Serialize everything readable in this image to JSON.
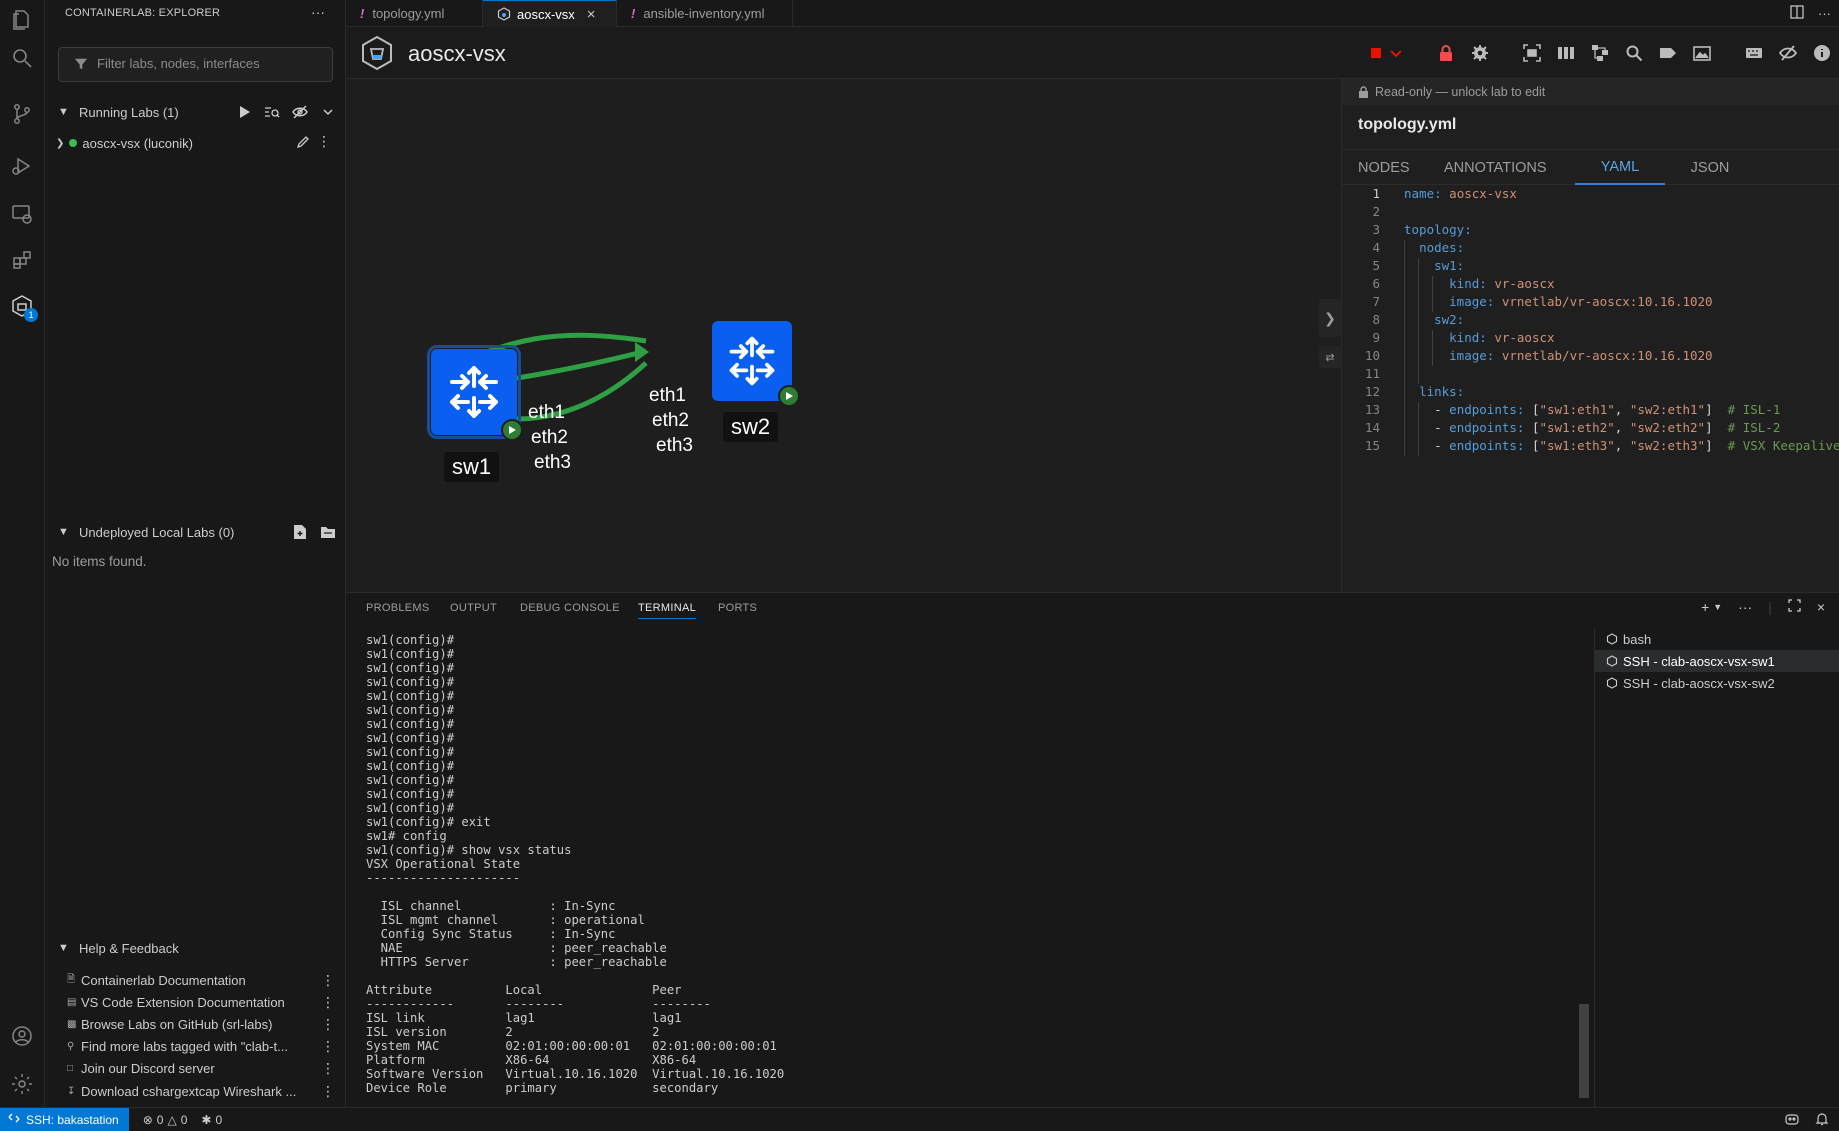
{
  "sidebar": {
    "title": "CONTAINERLAB: EXPLORER",
    "filter_placeholder": "Filter labs, nodes, interfaces",
    "running_labs": {
      "label": "Running Labs (1)",
      "items": [
        {
          "label": "aoscx-vsx (luconik)",
          "status": "running"
        }
      ]
    },
    "undeployed": {
      "label": "Undeployed Local Labs (0)",
      "empty_text": "No items found."
    },
    "help": {
      "label": "Help & Feedback",
      "items": [
        {
          "label": "Containerlab Documentation",
          "icon": "doc-icon"
        },
        {
          "label": "VS Code Extension Documentation",
          "icon": "doc-icon"
        },
        {
          "label": "Browse Labs on GitHub (srl-labs)",
          "icon": "folder-icon"
        },
        {
          "label": "Find more labs tagged with \"clab-t...",
          "icon": "search-icon"
        },
        {
          "label": "Join our Discord server",
          "icon": "chat-icon"
        },
        {
          "label": "Download cshargextcap Wireshark ...",
          "icon": "download-icon"
        }
      ]
    },
    "activity_badge": "1"
  },
  "tabs": [
    {
      "label": "topology.yml",
      "active": false
    },
    {
      "label": "aoscx-vsx",
      "active": true
    },
    {
      "label": "ansible-inventory.yml",
      "active": false
    }
  ],
  "graph": {
    "title": "aoscx-vsx",
    "nodes": [
      {
        "label": "sw1"
      },
      {
        "label": "sw2"
      }
    ],
    "sw1_ifaces": [
      "eth1",
      "eth2",
      "eth3"
    ],
    "sw2_ifaces": [
      "eth1",
      "eth2",
      "eth3"
    ]
  },
  "props": {
    "readonly_text": "Read-only — unlock lab to edit",
    "file_title": "topology.yml",
    "tabs": [
      "NODES",
      "ANNOTATIONS",
      "YAML",
      "JSON"
    ],
    "active_tab": "YAML",
    "yaml_lines": [
      "1",
      "2",
      "3",
      "4",
      "5",
      "6",
      "7",
      "8",
      "9",
      "10",
      "11",
      "12",
      "13",
      "14",
      "15"
    ],
    "yaml": {
      "name_key": "name:",
      "name_val": "aoscx-vsx",
      "topology_key": "topology:",
      "nodes_key": "nodes:",
      "sw1_key": "sw1:",
      "sw2_key": "sw2:",
      "kind_key": "kind:",
      "kind_val": "vr-aoscx",
      "image_key": "image:",
      "image_val": "vrnetlab/vr-aoscx:10.16.1020",
      "links_key": "links:",
      "endpoints_key": "endpoints:",
      "link1_a": "\"sw1:eth1\"",
      "link1_b": "\"sw2:eth1\"",
      "link1_c": "# ISL-1",
      "link2_a": "\"sw1:eth2\"",
      "link2_b": "\"sw2:eth2\"",
      "link2_c": "# ISL-2",
      "link3_a": "\"sw1:eth3\"",
      "link3_b": "\"sw2:eth3\"",
      "link3_c": "# VSX Keepalive"
    }
  },
  "panel": {
    "tabs": [
      "PROBLEMS",
      "OUTPUT",
      "DEBUG CONSOLE",
      "TERMINAL",
      "PORTS"
    ],
    "active_tab": "TERMINAL",
    "terminal_lines": [
      "sw1(config)#",
      "sw1(config)#",
      "sw1(config)#",
      "sw1(config)#",
      "sw1(config)#",
      "sw1(config)#",
      "sw1(config)#",
      "sw1(config)#",
      "sw1(config)#",
      "sw1(config)#",
      "sw1(config)#",
      "sw1(config)#",
      "sw1(config)#",
      "sw1(config)# exit",
      "sw1# config",
      "sw1(config)# show vsx status",
      "VSX Operational State",
      "---------------------",
      "",
      "  ISL channel            : In-Sync",
      "  ISL mgmt channel       : operational",
      "  Config Sync Status     : In-Sync",
      "  NAE                    : peer_reachable",
      "  HTTPS Server           : peer_reachable",
      "",
      "Attribute          Local               Peer",
      "------------       --------            --------",
      "ISL link           lag1                lag1",
      "ISL version        2                   2",
      "System MAC         02:01:00:00:00:01   02:01:00:00:00:01",
      "Platform           X86-64              X86-64",
      "Software Version   Virtual.10.16.1020  Virtual.10.16.1020",
      "Device Role        primary             secondary",
      ""
    ],
    "prompt": "sw1(config)# ",
    "terminals": [
      {
        "label": "bash"
      },
      {
        "label": "SSH - clab-aoscx-vsx-sw1"
      },
      {
        "label": "SSH - clab-aoscx-vsx-sw2"
      }
    ]
  },
  "status": {
    "remote": "SSH: bakastation",
    "errors": "0",
    "warnings": "0",
    "ports": "0"
  },
  "colors": {
    "accent": "#0078d4",
    "node": "#0a5ef0",
    "link": "#2ea043",
    "running": "#3fb950",
    "stop": "#e51400",
    "lock": "#f14c4c"
  }
}
